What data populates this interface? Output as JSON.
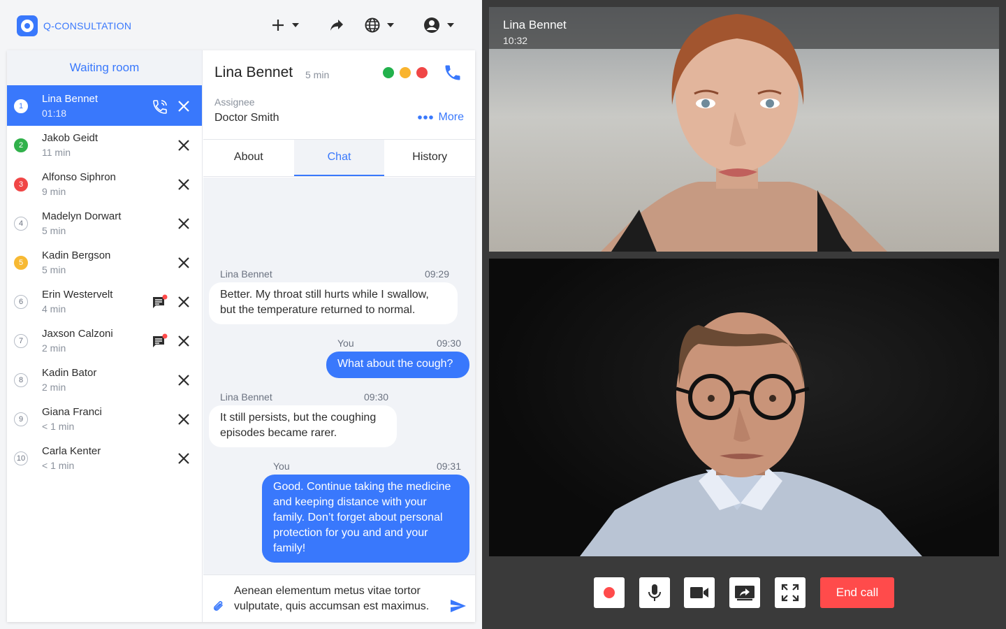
{
  "app": {
    "logo_text": "Q-CONSULTATION"
  },
  "header_actions": [
    {
      "name": "add-icon",
      "has_dropdown": true
    },
    {
      "name": "share-icon",
      "has_dropdown": false
    },
    {
      "name": "globe-icon",
      "has_dropdown": true
    },
    {
      "name": "account-icon",
      "has_dropdown": true
    }
  ],
  "waiting_room": {
    "title": "Waiting room",
    "queue": [
      {
        "number": "1",
        "name": "Lina Bennet",
        "time": "01:18",
        "status": "active"
      },
      {
        "number": "2",
        "name": "Jakob Geidt",
        "time": "11 min",
        "status": "green"
      },
      {
        "number": "3",
        "name": "Alfonso Siphron",
        "time": "9 min",
        "status": "red"
      },
      {
        "number": "4",
        "name": "Madelyn Dorwart",
        "time": "5 min",
        "status": "none"
      },
      {
        "number": "5",
        "name": "Kadin Bergson",
        "time": "5 min",
        "status": "yellow"
      },
      {
        "number": "6",
        "name": "Erin Westervelt",
        "time": "4 min",
        "status": "none",
        "has_new_message": true
      },
      {
        "number": "7",
        "name": "Jaxson Calzoni",
        "time": "2 min",
        "status": "none",
        "has_new_message": true
      },
      {
        "number": "8",
        "name": "Kadin Bator",
        "time": "2 min",
        "status": "none"
      },
      {
        "number": "9",
        "name": "Giana Franci",
        "time": "< 1 min",
        "status": "none"
      },
      {
        "number": "10",
        "name": "Carla Kenter",
        "time": "< 1 min",
        "status": "none"
      }
    ]
  },
  "patient": {
    "name": "Lina Bennet",
    "wait": "5 min",
    "assignee_label": "Assignee",
    "assignee": "Doctor Smith",
    "more_label": "More",
    "status_colors": [
      "#22b14c",
      "#f9b42e",
      "#f04646"
    ]
  },
  "tabs": [
    {
      "label": "About",
      "active": false
    },
    {
      "label": "Chat",
      "active": true
    },
    {
      "label": "History",
      "active": false
    }
  ],
  "messages": [
    {
      "sender": "Lina Bennet",
      "time": "09:29",
      "text": "Better. My throat still hurts while I swallow, but the temperature returned to normal.",
      "direction": "in"
    },
    {
      "sender": "You",
      "time": "09:30",
      "text": "What about the cough?",
      "direction": "out"
    },
    {
      "sender": "Lina Bennet",
      "time": "09:30",
      "text": "It still persists, but the coughing episodes became rarer.",
      "direction": "in"
    },
    {
      "sender": "You",
      "time": "09:31",
      "text": "Good. Continue taking the medicine and keeping distance with your family. Don’t forget about personal protection for you and and your family!",
      "direction": "out"
    }
  ],
  "composer": {
    "text": "Aenean elementum metus vitae tortor vulputate, quis accumsan est maximus."
  },
  "video": {
    "remote_name": "Lina Bennet",
    "remote_time": "10:32",
    "end_call_label": "End call",
    "controls": [
      "record-icon",
      "microphone-icon",
      "camera-icon",
      "screen-share-icon",
      "fullscreen-icon"
    ]
  },
  "colors": {
    "accent": "#3978fc",
    "end_call": "#ff4b4b",
    "video_bg": "#3a3a3a"
  }
}
